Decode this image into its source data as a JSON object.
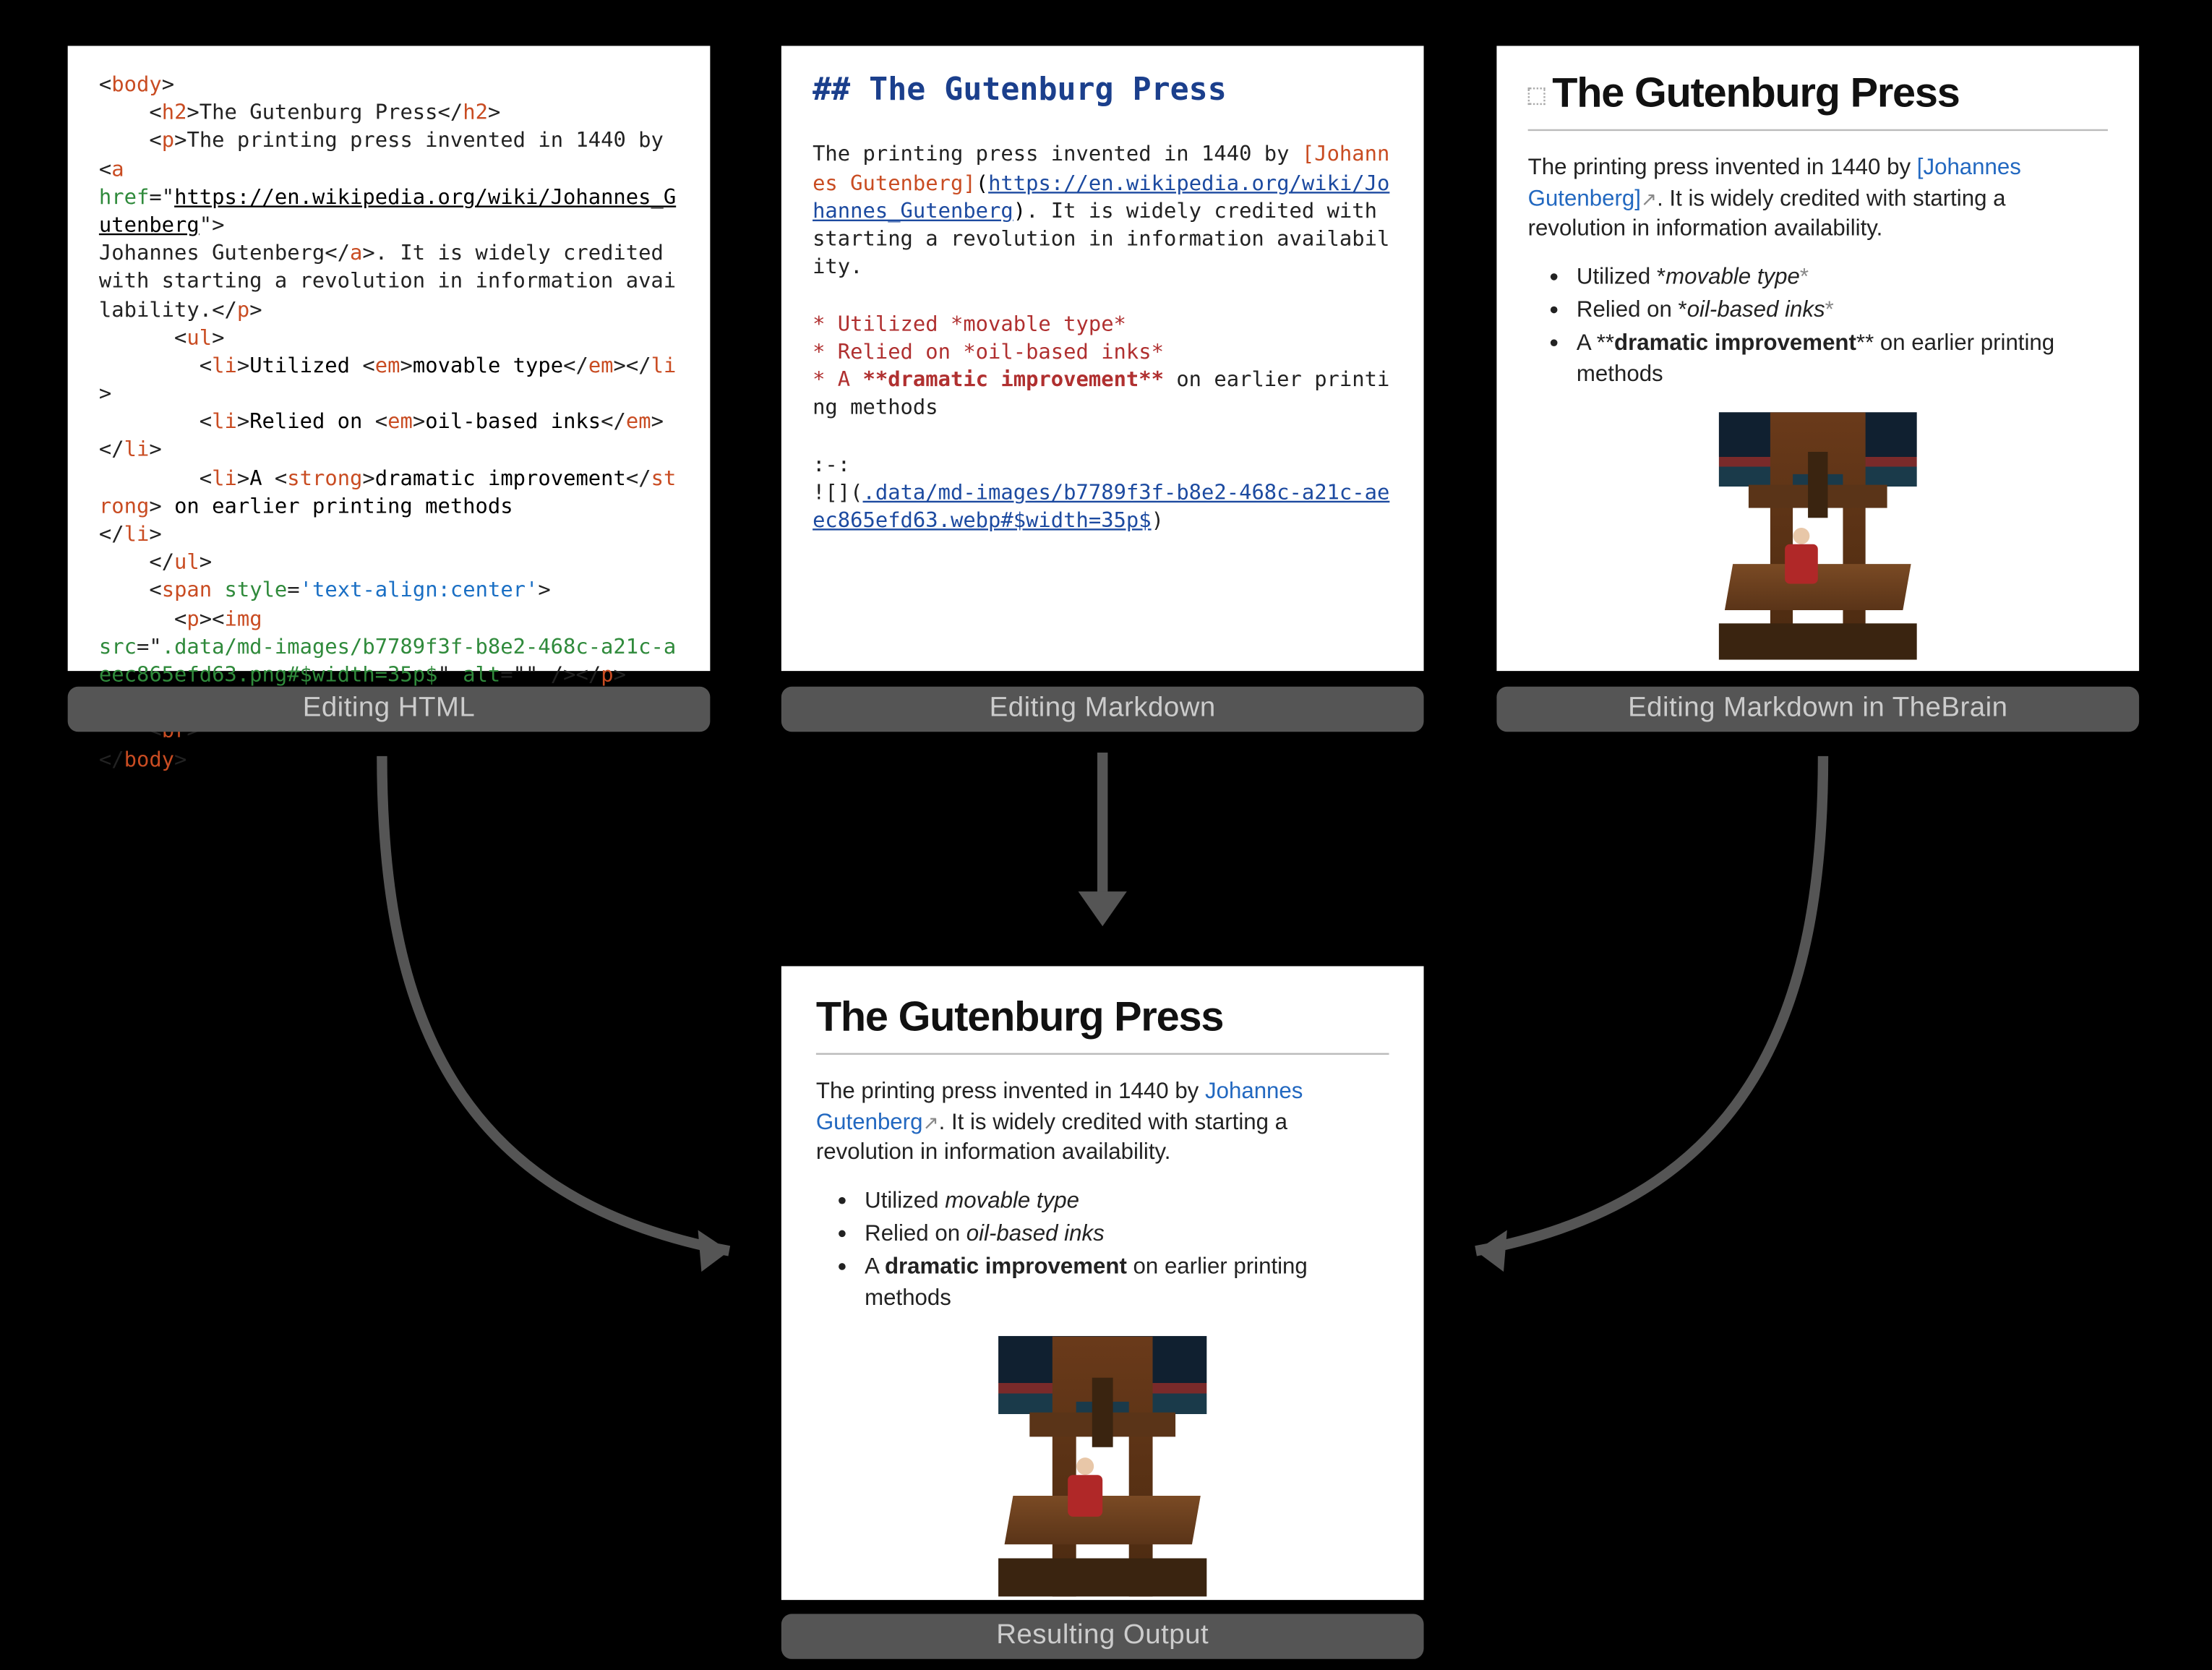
{
  "labels": {
    "html": "Editing HTML",
    "markdown": "Editing Markdown",
    "brain": "Editing Markdown in TheBrain",
    "output": "Resulting Output"
  },
  "document": {
    "title": "The Gutenburg Press",
    "intro_pre": "The printing press invented in 1440 by ",
    "link_text": "Johannes Gutenberg",
    "link_url": "https://en.wikipedia.org/wiki/Johannes_Gutenberg",
    "intro_post": ". It is widely credited with starting a revolution in information availability.",
    "bullets": [
      {
        "pre": "Utilized ",
        "em": "movable type",
        "post": ""
      },
      {
        "pre": "Relied on ",
        "em": "oil-based inks",
        "post": ""
      },
      {
        "pre": "A ",
        "strong": "dramatic improvement",
        "post": " on earlier printing methods"
      }
    ],
    "image_src_html": ".data/md-images/b7789f3f-b8e2-468c-a21c-aeec865efd63.png#$width=35p$",
    "image_src_md": ".data/md-images/b7789f3f-b8e2-468c-a21c-aeec865efd63.webp#$width=35p$",
    "span_style": "text-align:center"
  },
  "md_raw": {
    "star_line1": "* Utilized *movable type*",
    "star_line2": "* Relied on *oil-based inks*",
    "star_line3_a": "* A ",
    "star_line3_b": "**dramatic improvement**",
    "star_line3_c": " on earlier printing methods",
    "center": ":-:",
    "img_open": "![](",
    "img_close": ")"
  },
  "brain_raw": {
    "b1_pre": "Utilized *",
    "b1_em": "movable type",
    "b1_post": "*",
    "b2_pre": "Relied on *",
    "b2_em": "oil-based inks",
    "b2_post": "*",
    "b3_pre": "A **",
    "b3_strong": "dramatic improvement",
    "b3_post": "** on earlier printing methods"
  }
}
